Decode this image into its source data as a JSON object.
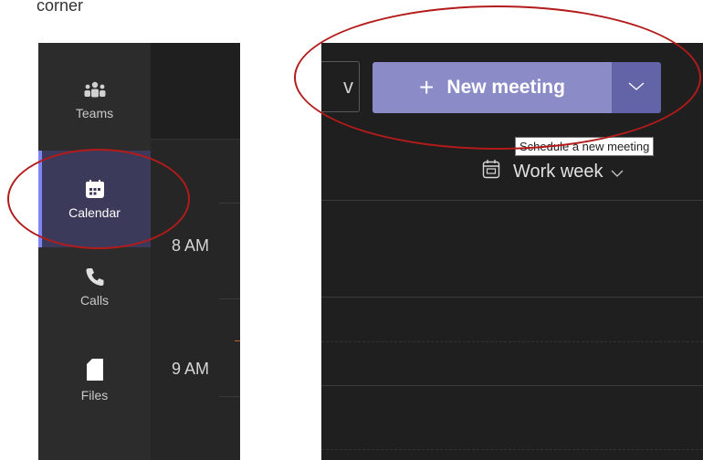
{
  "corner_text": "corner",
  "rail": {
    "items": [
      {
        "label": "Teams",
        "icon": "teams-icon"
      },
      {
        "label": "Calendar",
        "icon": "calendar-icon",
        "active": true
      },
      {
        "label": "Calls",
        "icon": "phone-icon"
      },
      {
        "label": "Files",
        "icon": "file-icon"
      }
    ]
  },
  "times": [
    "8 AM",
    "9 AM"
  ],
  "toolbar": {
    "today_fragment": "v",
    "new_meeting_label": "New meeting",
    "tooltip": "Schedule a new meeting"
  },
  "view": {
    "label": "Work week"
  },
  "colors": {
    "accent": "#6264a7",
    "accent_light": "#8b8cc7",
    "annotation": "#b31b1b"
  }
}
